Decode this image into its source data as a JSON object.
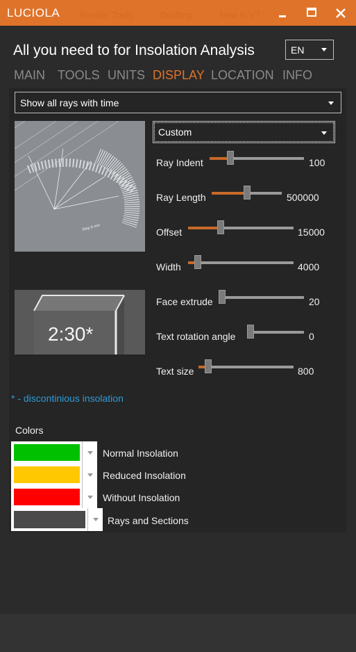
{
  "window": {
    "app_name": "LUCIOLA",
    "ghost_tabs": [
      "Render Tools",
      "Drafting",
      "New in V7"
    ],
    "minimize_icon": "minimize-icon",
    "maximize_icon": "maximize-icon",
    "close_icon": "close-icon"
  },
  "header": {
    "title": "All you need to for Insolation Analysis",
    "language": "EN"
  },
  "tabs": [
    {
      "label": "MAIN",
      "active": false
    },
    {
      "label": "TOOLS",
      "active": false
    },
    {
      "label": "UNITS",
      "active": false
    },
    {
      "label": "DISPLAY",
      "active": true
    },
    {
      "label": "LOCATION",
      "active": false
    },
    {
      "label": "INFO",
      "active": false
    }
  ],
  "display": {
    "ray_mode": "Show all rays with time",
    "preset": "Custom",
    "preview_step_label": "Step 6 min",
    "preview_time_label": "2:30*",
    "sliders": [
      {
        "label": "Ray Indent",
        "value": "100",
        "fraction": 0.22
      },
      {
        "label": "Ray Length",
        "value": "500000",
        "fraction": 0.5
      },
      {
        "label": "Offset",
        "value": "15000",
        "fraction": 0.31
      },
      {
        "label": "Width",
        "value": "4000",
        "fraction": 0.09
      },
      {
        "label": "Face extrude",
        "value": "20",
        "fraction": 0.04
      },
      {
        "label": "Text rotation angle",
        "value": "0",
        "fraction": 0.0
      },
      {
        "label": "Text size",
        "value": "800",
        "fraction": 0.1
      }
    ],
    "note": "* - discontinious insolation"
  },
  "colors": {
    "heading": "Colors",
    "items": [
      {
        "label": "Normal Insolation",
        "color": "#00c000"
      },
      {
        "label": "Reduced Insolation",
        "color": "#ffc800"
      },
      {
        "label": "Without Insolation",
        "color": "#ff0000"
      },
      {
        "label": "Rays and Sections",
        "color": "#4a4a4a"
      }
    ]
  }
}
